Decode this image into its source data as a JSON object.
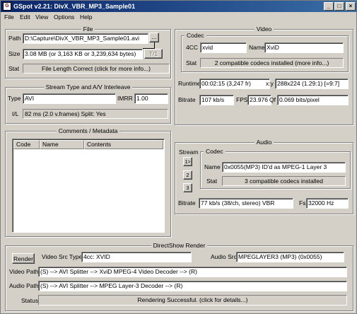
{
  "window": {
    "title": "GSpot v2.21: DivX_VBR_MP3_Sample01"
  },
  "menu": [
    "File",
    "Edit",
    "View",
    "Options",
    "Help"
  ],
  "file": {
    "title": "File",
    "path_label": "Path",
    "path_value": "D:\\Capture\\DivX_VBR_MP3_Sample01.avi",
    "browse_label": "...",
    "size_label": "Size",
    "size_value": "3.08 MB (or 3,163 KB or 3,239,634 bytes)",
    "t1_label": "T/1",
    "stat_label": "Stat",
    "stat_value": "File Length Correct (click for more info...)"
  },
  "stream": {
    "title": "Stream Type and A/V Interleave",
    "type_label": "Type",
    "type_value": "AVI",
    "imrr_label": "IMRR",
    "imrr_value": "1.00",
    "il_label": "I/L",
    "il_value": "82 ms (2.0 v.frames)  Split: Yes"
  },
  "comments": {
    "title": "Comments / Metadata",
    "columns": [
      "Code",
      "Name",
      "Contents"
    ]
  },
  "video": {
    "title": "Video",
    "codec_title": "Codec",
    "fourcc_label": "4CC",
    "fourcc_value": "xvid",
    "name_label": "Name",
    "name_value": "XviD",
    "stat_label": "Stat",
    "stat_value": "2 compatible codecs installed (more info...)",
    "runtime_label": "Runtime",
    "runtime_value": "00:02:15 (3,247 fr)",
    "xy_label": "x:y",
    "xy_value": "288x224 (1.29:1) [=9:7]",
    "bitrate_label": "Bitrate",
    "bitrate_value": "107 kb/s",
    "fps_label": "FPS",
    "fps_value": "23.976",
    "qf_label": "Qf",
    "qf_value": "0.069 bits/pixel"
  },
  "audio": {
    "title": "Audio",
    "stream_label": "Stream",
    "stream_buttons": [
      "1>",
      "2",
      "3"
    ],
    "codec_title": "Codec",
    "name_label": "Name",
    "name_value": "0x0055(MP3) ID'd as MPEG-1 Layer 3",
    "stat_label": "Stat",
    "stat_value": "3 compatible codecs installed",
    "bitrate_label": "Bitrate",
    "bitrate_value": "77 kb/s (38/ch, stereo) VBR",
    "fs_label": "Fs",
    "fs_value": "32000 Hz"
  },
  "directshow": {
    "title": "DirectShow Render",
    "render_label": "Render",
    "video_src_label": "Video Src Type",
    "video_src_value": "4cc: XVID",
    "audio_src_label": "Audio Src",
    "audio_src_value": "MPEGLAYER3 (MP3) (0x0055)",
    "video_path_label": "Video Path",
    "video_path_value": "(S) --> AVI Splitter --> XviD MPEG-4 Video Decoder --> (R)",
    "audio_path_label": "Audio Path",
    "audio_path_value": "(S) --> AVI Splitter --> MPEG Layer-3 Decoder --> (R)",
    "status_label": "Status",
    "status_value": "Rendering Successful.  (click for details...)"
  }
}
